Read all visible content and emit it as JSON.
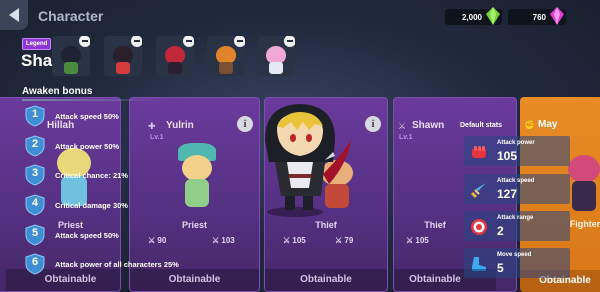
{
  "header": {
    "title": "Character",
    "gold": "2,000",
    "gems": "760"
  },
  "character": {
    "rarity": "Legend",
    "name": "Shawn"
  },
  "equipment_slots": [
    {
      "name": "slot-1"
    },
    {
      "name": "slot-2"
    },
    {
      "name": "slot-3"
    },
    {
      "name": "slot-4"
    },
    {
      "name": "slot-5"
    }
  ],
  "awaken": {
    "title": "Awaken bonus",
    "items": [
      {
        "num": "1",
        "text": "Attack speed 50%"
      },
      {
        "num": "2",
        "text": "Attack power 50%"
      },
      {
        "num": "3",
        "text": "Critical chance: 21%"
      },
      {
        "num": "4",
        "text": "Critical damage 30%"
      },
      {
        "num": "5",
        "text": "Attack speed 50%"
      },
      {
        "num": "6",
        "text": "Attack power of all characters 25%"
      }
    ]
  },
  "cards": [
    {
      "name": "Hillah",
      "level": "",
      "class": "Priest",
      "stat1": "",
      "stat2": "",
      "action": "Obtainable"
    },
    {
      "name": "Yulrin",
      "level": "Lv.1",
      "class": "Priest",
      "stat1": "90",
      "stat2": "103",
      "action": "Obtainable"
    },
    {
      "name": "",
      "level": "",
      "class": "Thief",
      "stat1": "105",
      "stat2": "79",
      "action": "Obtainable"
    },
    {
      "name": "Shawn",
      "level": "Lv.1",
      "class": "Thief",
      "stat1": "105",
      "stat2": "",
      "action": "Obtainable"
    },
    {
      "name": "May",
      "level": "",
      "class": "Fighter",
      "stat1": "",
      "stat2": "",
      "action": "Obtainable"
    }
  ],
  "default_stats": {
    "title": "Default stats",
    "items": [
      {
        "label": "Attack power",
        "value": "105",
        "icon": "fist-icon"
      },
      {
        "label": "Attack speed",
        "value": "127",
        "icon": "sword-icon"
      },
      {
        "label": "Attack range",
        "value": "2",
        "icon": "target-icon"
      },
      {
        "label": "Move speed",
        "value": "5",
        "icon": "boot-icon"
      }
    ]
  },
  "colors": {
    "legend": "#8c37d8",
    "card_purple": "#6a3a9c",
    "card_orange": "#e88c26",
    "shield_blue": "#3f8fd6",
    "stat_panel": "#28468a"
  }
}
